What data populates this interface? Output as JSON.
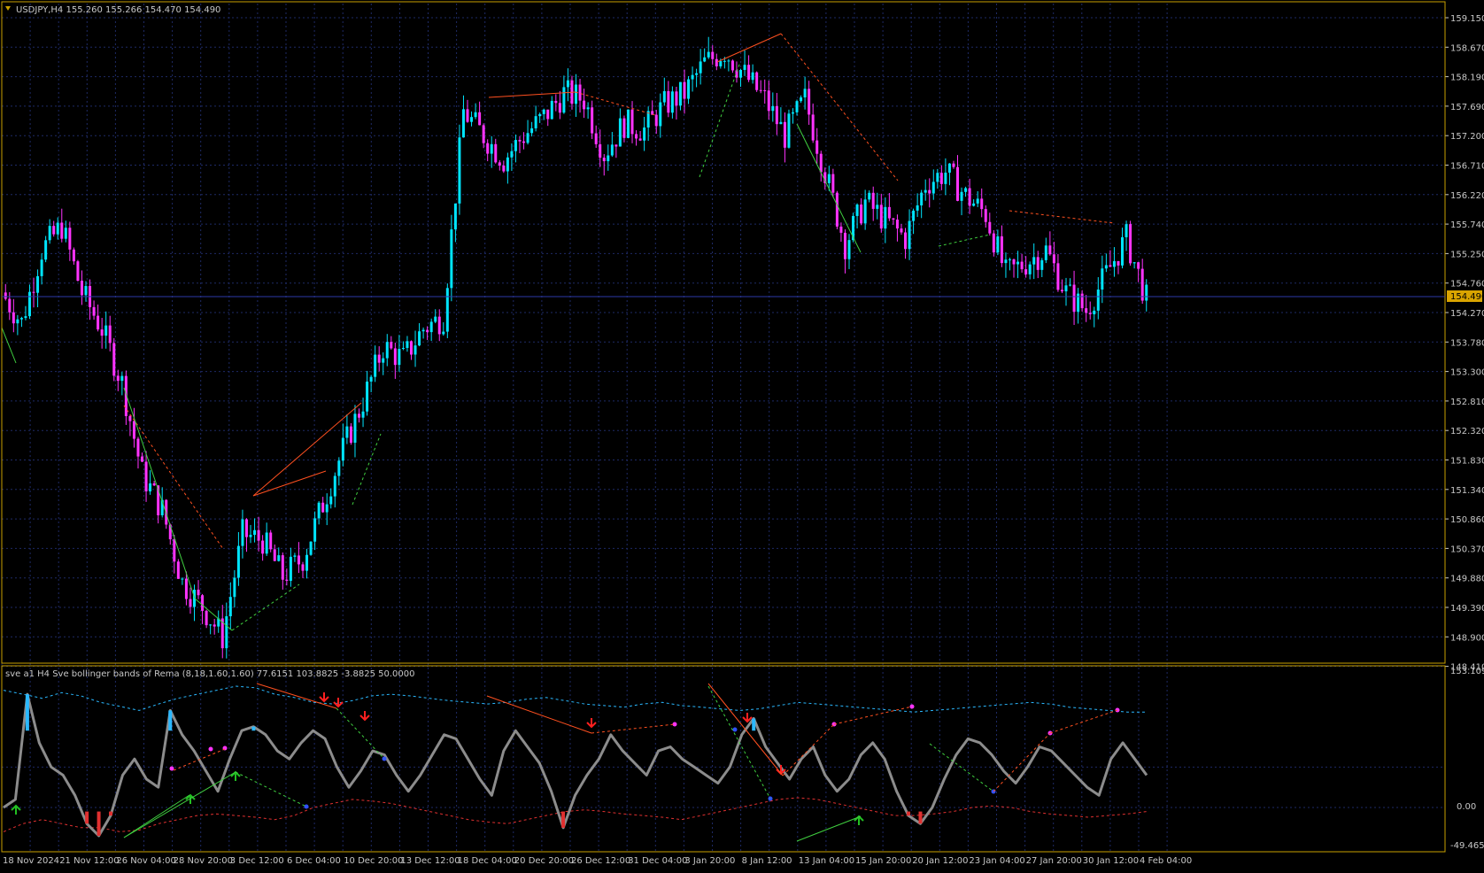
{
  "main_chart": {
    "header": "USDJPY,H4  155.260 155.266 154.470 154.490",
    "price_labels": [
      "159.150",
      "158.670",
      "158.190",
      "157.690",
      "157.200",
      "156.710",
      "156.220",
      "155.740",
      "155.250",
      "154.760",
      "154.270",
      "153.780",
      "153.300",
      "152.810",
      "152.320",
      "151.830",
      "151.340",
      "150.860",
      "150.370",
      "149.880",
      "149.390",
      "148.900",
      "148.410"
    ],
    "current_price": "154.490"
  },
  "indicator": {
    "header": "sve a1 H4 Sve bollinger bands of Rema (8,18,1.60,1.60) 77.6151 103.8825 -3.8825 50.0000",
    "scale_labels": [
      "153.1094",
      "0.00",
      "-49.4651"
    ]
  },
  "time_axis": [
    "18 Nov 2024",
    "21 Nov 12:00",
    "26 Nov 04:00",
    "28 Nov 20:00",
    "3 Dec 12:00",
    "6 Dec 04:00",
    "10 Dec 20:00",
    "13 Dec 12:00",
    "18 Dec 04:00",
    "20 Dec 20:00",
    "26 Dec 12:00",
    "31 Dec 04:00",
    "3 Jan 20:00",
    "8 Jan 12:00",
    "13 Jan 04:00",
    "15 Jan 20:00",
    "20 Jan 12:00",
    "23 Jan 04:00",
    "27 Jan 20:00",
    "30 Jan 12:00",
    "4 Feb 04:00"
  ],
  "colors": {
    "background": "#000000",
    "grid": "#1e2a66",
    "border": "#c8a000",
    "bull": "#00e5ff",
    "bear": "#ff33ff",
    "axis_text": "#c8c8c8",
    "bid_line": "#2d3aa8",
    "price_tag_bg": "#d9a400",
    "osc_line": "#8c8c8c",
    "band_upper": "#2ab8ff",
    "band_lower": "#e03030",
    "arrow_up": "#22c022",
    "arrow_down": "#ff2020"
  },
  "chart_data": [
    {
      "type": "candlestick",
      "title": "USDJPY,H4",
      "ohlc_header": {
        "open": 155.26,
        "high": 155.266,
        "low": 154.47,
        "close": 154.49
      },
      "x_labels": [
        "18 Nov 2024",
        "21 Nov 12:00",
        "26 Nov 04:00",
        "28 Nov 20:00",
        "3 Dec 12:00",
        "6 Dec 04:00",
        "10 Dec 20:00",
        "13 Dec 12:00",
        "18 Dec 04:00",
        "20 Dec 20:00",
        "26 Dec 12:00",
        "31 Dec 04:00",
        "3 Jan 20:00",
        "8 Jan 12:00",
        "13 Jan 04:00",
        "15 Jan 20:00",
        "20 Jan 12:00",
        "23 Jan 04:00",
        "27 Jan 20:00",
        "30 Jan 12:00",
        "4 Feb 04:00"
      ],
      "ylim": [
        148.41,
        159.39
      ],
      "close_path": [
        {
          "t": "18 Nov 2024",
          "v": 154.6
        },
        {
          "t": "19 Nov",
          "v": 154.1
        },
        {
          "t": "20 Nov",
          "v": 155.3
        },
        {
          "t": "21 Nov 12:00",
          "v": 155.7
        },
        {
          "t": "22 Nov",
          "v": 154.6
        },
        {
          "t": "25 Nov",
          "v": 154.0
        },
        {
          "t": "26 Nov 04:00",
          "v": 153.1
        },
        {
          "t": "27 Nov",
          "v": 151.6
        },
        {
          "t": "28 Nov",
          "v": 151.0
        },
        {
          "t": "28 Nov 20:00",
          "v": 149.8
        },
        {
          "t": "2 Dec",
          "v": 149.4
        },
        {
          "t": "3 Dec",
          "v": 148.9
        },
        {
          "t": "3 Dec 12:00",
          "v": 150.6
        },
        {
          "t": "4 Dec",
          "v": 150.5
        },
        {
          "t": "5 Dec",
          "v": 149.9
        },
        {
          "t": "6 Dec 04:00",
          "v": 150.2
        },
        {
          "t": "9 Dec",
          "v": 151.1
        },
        {
          "t": "10 Dec 20:00",
          "v": 152.0
        },
        {
          "t": "11 Dec",
          "v": 152.8
        },
        {
          "t": "13 Dec 12:00",
          "v": 153.7
        },
        {
          "t": "16 Dec",
          "v": 153.5
        },
        {
          "t": "17 Dec",
          "v": 154.0
        },
        {
          "t": "18 Dec 04:00",
          "v": 154.2
        },
        {
          "t": "19 Dec",
          "v": 157.6
        },
        {
          "t": "20 Dec",
          "v": 157.2
        },
        {
          "t": "20 Dec 20:00",
          "v": 156.8
        },
        {
          "t": "24 Dec",
          "v": 157.2
        },
        {
          "t": "25 Dec",
          "v": 157.5
        },
        {
          "t": "26 Dec 12:00",
          "v": 157.9
        },
        {
          "t": "27 Dec",
          "v": 157.8
        },
        {
          "t": "30 Dec",
          "v": 156.9
        },
        {
          "t": "31 Dec 04:00",
          "v": 157.4
        },
        {
          "t": "2 Jan",
          "v": 157.3
        },
        {
          "t": "3 Jan 20:00",
          "v": 157.7
        },
        {
          "t": "6 Jan",
          "v": 157.9
        },
        {
          "t": "7 Jan",
          "v": 158.4
        },
        {
          "t": "8 Jan 12:00",
          "v": 158.6
        },
        {
          "t": "9 Jan",
          "v": 158.2
        },
        {
          "t": "10 Jan",
          "v": 157.8
        },
        {
          "t": "13 Jan 04:00",
          "v": 157.2
        },
        {
          "t": "14 Jan",
          "v": 157.8
        },
        {
          "t": "15 Jan",
          "v": 156.6
        },
        {
          "t": "15 Jan 20:00",
          "v": 155.4
        },
        {
          "t": "16 Jan",
          "v": 156.1
        },
        {
          "t": "17 Jan",
          "v": 155.8
        },
        {
          "t": "20 Jan 12:00",
          "v": 155.5
        },
        {
          "t": "21 Jan",
          "v": 156.4
        },
        {
          "t": "22 Jan",
          "v": 156.6
        },
        {
          "t": "23 Jan 04:00",
          "v": 156.2
        },
        {
          "t": "24 Jan",
          "v": 155.9
        },
        {
          "t": "24 Jan 20:00",
          "v": 154.9
        },
        {
          "t": "27 Jan 20:00",
          "v": 155.1
        },
        {
          "t": "28 Jan",
          "v": 155.3
        },
        {
          "t": "29 Jan",
          "v": 154.6
        },
        {
          "t": "30 Jan 12:00",
          "v": 154.3
        },
        {
          "t": "31 Jan",
          "v": 154.9
        },
        {
          "t": "3 Feb",
          "v": 155.5
        },
        {
          "t": "4 Feb 04:00",
          "v": 154.49
        }
      ]
    },
    {
      "type": "line",
      "title": "sve a1 H4 Sve bollinger bands of Rema (8,18,1.60,1.60)",
      "header_values": [
        77.6151,
        103.8825,
        -3.8825,
        50.0
      ],
      "ylim": [
        -49.4651,
        153.1094
      ],
      "series": [
        {
          "values": [
            0,
            10,
            140,
            80,
            50,
            40,
            15,
            -20,
            -35,
            -10,
            40,
            60,
            35,
            25,
            120,
            90,
            70,
            45,
            20,
            60,
            95,
            100,
            90,
            70,
            60,
            80,
            95,
            85,
            50,
            25,
            45,
            70,
            65,
            40,
            20,
            40,
            65,
            90,
            85,
            60,
            35,
            15,
            70,
            95,
            75,
            55,
            20,
            -25,
            15,
            40,
            60,
            90,
            70,
            55,
            40,
            70,
            75,
            60,
            50,
            40,
            30,
            50,
            90,
            110,
            75,
            55,
            35,
            60,
            75,
            40,
            20,
            35,
            65,
            80,
            60,
            20,
            -10,
            -20,
            0,
            35,
            65,
            85,
            80,
            65,
            45,
            30,
            50,
            75,
            70,
            55,
            40,
            25,
            15,
            60,
            80,
            60,
            40
          ]
        },
        {
          "values": [
            145,
            140,
            135,
            142,
            138,
            130,
            125,
            120,
            128,
            135,
            140,
            145,
            150,
            148,
            140,
            136,
            130,
            128,
            132,
            138,
            140,
            138,
            135,
            132,
            130,
            128,
            130,
            134,
            136,
            132,
            128,
            126,
            124,
            128,
            130,
            126,
            124,
            122,
            120,
            122,
            126,
            130,
            128,
            126,
            124,
            122,
            120,
            118,
            120,
            122,
            124,
            126,
            128,
            130,
            128,
            124,
            122,
            120,
            118,
            118
          ]
        },
        {
          "values": [
            -30,
            -20,
            -15,
            -20,
            -25,
            -25,
            -30,
            -28,
            -20,
            -15,
            -10,
            -8,
            -10,
            -12,
            -15,
            -10,
            0,
            5,
            10,
            8,
            5,
            0,
            -5,
            -10,
            -15,
            -18,
            -20,
            -15,
            -10,
            -5,
            -3,
            -5,
            -8,
            -10,
            -12,
            -15,
            -10,
            -5,
            0,
            5,
            10,
            12,
            10,
            5,
            0,
            -5,
            -10,
            -10,
            -8,
            -5,
            0,
            2,
            0,
            -5,
            -8,
            -10,
            -12,
            -10,
            -8,
            -5
          ]
        }
      ],
      "reference_levels": [
        0,
        100
      ]
    }
  ]
}
